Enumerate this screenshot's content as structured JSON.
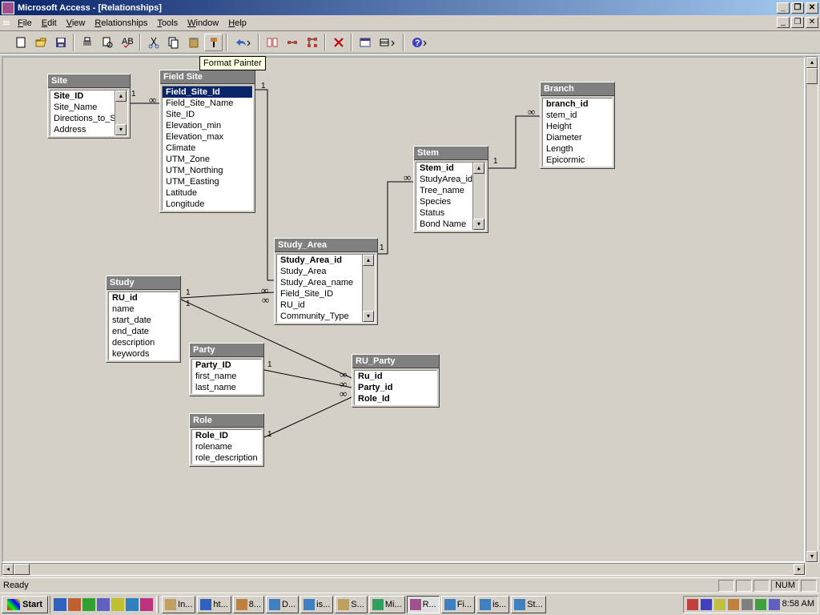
{
  "title": "Microsoft Access - [Relationships]",
  "menus": {
    "file": "File",
    "edit": "Edit",
    "view": "View",
    "relationships": "Relationships",
    "tools": "Tools",
    "window": "Window",
    "help": "Help"
  },
  "tooltip": "Format Painter",
  "status": {
    "ready": "Ready",
    "num": "NUM"
  },
  "tables": {
    "site": {
      "title": "Site",
      "fields": [
        "Site_ID",
        "Site_Name",
        "Directions_to_Si",
        "Address"
      ]
    },
    "fieldsite": {
      "title": "Field Site",
      "fields": [
        "Field_Site_Id",
        "Field_Site_Name",
        "Site_ID",
        "Elevation_min",
        "Elevation_max",
        "Climate",
        "UTM_Zone",
        "UTM_Northing",
        "UTM_Easting",
        "Latitude",
        "Longitude"
      ]
    },
    "studyarea": {
      "title": "Study_Area",
      "fields": [
        "Study_Area_id",
        "Study_Area",
        "Study_Area_name",
        "Field_Site_ID",
        "RU_id",
        "Community_Type"
      ]
    },
    "stem": {
      "title": "Stem",
      "fields": [
        "Stem_id",
        "StudyArea_id",
        "Tree_name",
        "Species",
        "Status",
        "Bond Name"
      ]
    },
    "branch": {
      "title": "Branch",
      "fields": [
        "branch_id",
        "stem_id",
        "Height",
        "Diameter",
        "Length",
        "Epicormic"
      ]
    },
    "study": {
      "title": "Study",
      "fields": [
        "RU_id",
        "name",
        "start_date",
        "end_date",
        "description",
        "keywords"
      ]
    },
    "party": {
      "title": "Party",
      "fields": [
        "Party_ID",
        "first_name",
        "last_name"
      ]
    },
    "role": {
      "title": "Role",
      "fields": [
        "Role_ID",
        "rolename",
        "role_description"
      ]
    },
    "ruparty": {
      "title": "RU_Party",
      "fields": [
        "Ru_id",
        "Party_id",
        "Role_Id"
      ]
    }
  },
  "cardinality": {
    "one": "1",
    "many": "∞"
  },
  "taskbar": {
    "start": "Start",
    "tasks": [
      "In...",
      "ht...",
      "8...",
      "D...",
      "is...",
      "S...",
      "Mi...",
      "R...",
      "Fi...",
      "is...",
      "St..."
    ],
    "clock": "8:58 AM"
  },
  "icon_colors": {
    "new": "#fff",
    "open": "#f0c040",
    "save": "#404080",
    "print": "#808080",
    "preview": "#606060",
    "spell": "#3060c0",
    "cut": "#808080",
    "copy": "#c0a060",
    "paste": "#c0a060",
    "brush": "#c08040",
    "undo": "#3060c0",
    "rel1": "#c04040",
    "rel2": "#c04040",
    "x": "#c00000",
    "show": "#808080",
    "table": "#404080",
    "help": "#4040c0"
  }
}
